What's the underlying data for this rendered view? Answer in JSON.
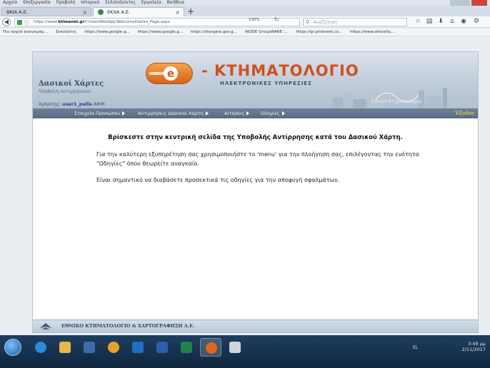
{
  "browser": {
    "menubar": [
      "Αρχείο",
      "Επεξεργασία",
      "Προβολή",
      "Ιστορικό",
      "Σελιδοδείκτες",
      "Εργαλεία",
      "Βοήθεια"
    ],
    "tabs": [
      {
        "label": "ΒΚΙΑ Α.Ε.",
        "active": false
      },
      {
        "label": "ΕΚΧΑ Α.Ε.",
        "active": true
      }
    ],
    "url_prefix": "https://www.",
    "url_domain": "ktimanet.gr",
    "url_path": "/CitizenWebApp/WelcomeDasika_Page.aspx",
    "zoom": "100%",
    "search_placeholder": "Αναζήτηση",
    "bookmarks": [
      "Πιο συχνά αναγνωσμ...",
      "Σοκολάτες",
      "https://www.google.g...",
      "https://www.google.g...",
      "https://diavgeia.gov.g...",
      "iNODE GroupWARE :...",
      "https://gr.pinterest.co...",
      "https://www.dressilly...."
    ]
  },
  "site": {
    "title": "Δασικοί Χάρτες",
    "subtitle": "Υποβολή αντιρρήσεων",
    "user_label": "Χρήστης:",
    "user_name": "user1_pella",
    "afm_label": "ΑΦΜ:",
    "logo_letter": "e",
    "logo_text": "- ΚΤΗΜΑΤΟΛΟΓΙΟ",
    "logo_sub": "ΗΛΕΚΤΡΟΝΙΚΕΣ ΥΠΗΡΕΣΙΕΣ",
    "header_brand": "Εθνικό Κτηματολόγιο",
    "nav": [
      {
        "label": "Στοιχεία Προσώπου"
      },
      {
        "label": "Αντιρρήσεις Δασικού Χάρτη"
      },
      {
        "label": "Αιτήσεις"
      },
      {
        "label": "Οδηγίες"
      }
    ],
    "logout": "Έξοδος",
    "welcome": "Βρίσκεστε στην κεντρική σελίδα της Υποβολής Αντίρρησης κατά του Δασικού Χάρτη.",
    "para1": "Για την καλύτερη εξυπηρέτηση σας χρησιμοποιήστε το 'menu' για την πλοήγηση σας, επιλέγοντας την ενότητα \"Οδηγίες\" όπου θεωρείτε αναγκαίο.",
    "para2": "Είναι σημαντικό να διαβάσετε προσεκτικά τις οδηγίες για την αποφυγή σφαλμάτων.",
    "footer": "ΕΘΝΙΚΟ ΚΤΗΜΑΤΟΛΟΓΙΟ & ΧΑΡΤΟΓΡΑΦΗΣΗ Α.Ε."
  },
  "taskbar": {
    "language": "EL",
    "time": "3:49 μμ",
    "date": "2/11/2017"
  },
  "colors": {
    "accent_orange": "#d0501f",
    "nav_bg": "#566a80",
    "logout_yellow": "#ffe033",
    "user_blue": "#1f3f9a"
  }
}
